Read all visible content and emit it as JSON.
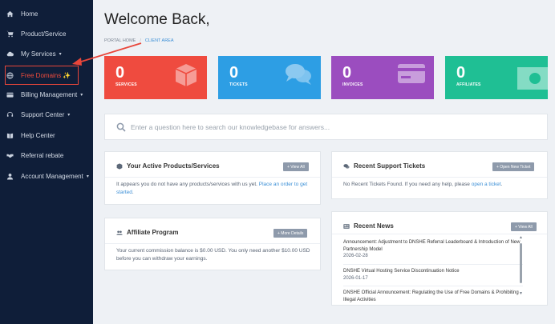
{
  "sidebar": {
    "items": [
      {
        "label": "Home",
        "icon": "home-icon"
      },
      {
        "label": "Product/Service",
        "icon": "cart-icon"
      },
      {
        "label": "My Services",
        "icon": "cloud-icon",
        "caret": "▾"
      },
      {
        "label": "Free Domains",
        "icon": "globe-icon",
        "badge": "✨"
      },
      {
        "label": "Billing Management",
        "icon": "credit-card-icon",
        "caret": "▾"
      },
      {
        "label": "Support Center",
        "icon": "support-icon",
        "caret": "▾"
      },
      {
        "label": "Help Center",
        "icon": "book-icon"
      },
      {
        "label": "Referral rebate",
        "icon": "handshake-icon"
      },
      {
        "label": "Account Management",
        "icon": "user-icon",
        "caret": "▾"
      }
    ]
  },
  "header": {
    "title": "Welcome Back,",
    "breadcrumb": {
      "home": "PORTAL HOME",
      "separator": "/",
      "current": "CLIENT AREA"
    }
  },
  "stats": [
    {
      "value": "0",
      "label": "SERVICES",
      "color": "#ef4b3f",
      "icon": "cube-icon"
    },
    {
      "value": "0",
      "label": "TICKETS",
      "color": "#2d9ee4",
      "icon": "chat-icon"
    },
    {
      "value": "0",
      "label": "INVOICES",
      "color": "#9b4dbf",
      "icon": "credit-card-icon"
    },
    {
      "value": "0",
      "label": "AFFILIATES",
      "color": "#1fbf94",
      "icon": "money-icon"
    }
  ],
  "search": {
    "placeholder": "Enter a question here to search our knowledgebase for answers..."
  },
  "products_panel": {
    "title": "Your Active Products/Services",
    "button": "+ View All",
    "text": "It appears you do not have any products/services with us yet.",
    "link": "Place an order to get started",
    "text_end": "."
  },
  "tickets_panel": {
    "title": "Recent Support Tickets",
    "button": "+ Open New Ticket",
    "text": "No Recent Tickets Found. If you need any help, please",
    "link": "open a ticket",
    "text_end": "."
  },
  "affiliate_panel": {
    "title": "Affiliate Program",
    "button": "+ More Details",
    "text": "Your current commission balance is $0.00 USD. You only need another $10.00 USD before you can withdraw your earnings."
  },
  "news_panel": {
    "title": "Recent News",
    "button": "+ View All",
    "items": [
      {
        "title": "Announcement: Adjustment to DNSHE Referral Leaderboard & Introduction of New Partnership Model",
        "date": "2026-02-28"
      },
      {
        "title": "DNSHE Virtual Hosting Service Discontinuation Notice",
        "date": "2026-01-17"
      },
      {
        "title": "DNSHE Official Announcement: Regulating the Use of Free Domains & Prohibiting Illegal Activities",
        "date": ""
      }
    ]
  },
  "colors": {
    "sidebar_bg": "#0f1e39",
    "accent_red": "#e8463a",
    "link": "#3b8fd6"
  }
}
